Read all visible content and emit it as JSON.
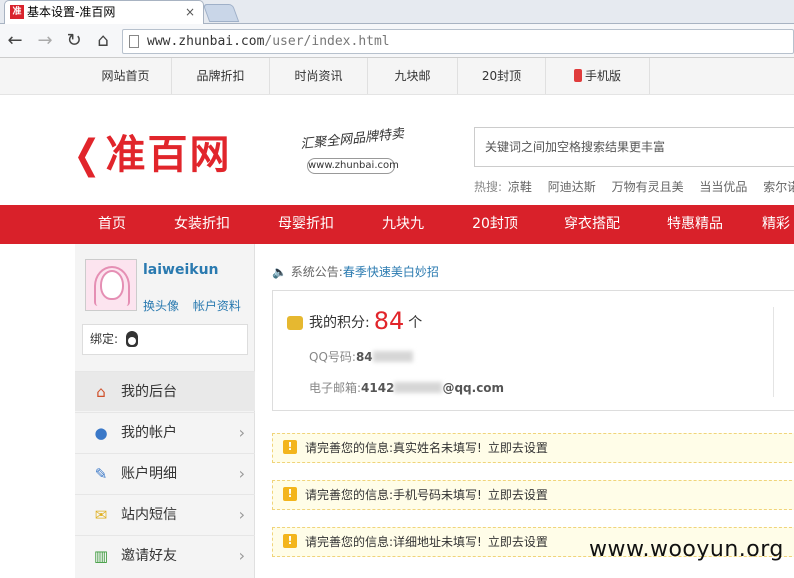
{
  "browser": {
    "tab_title": "基本设置-准百网",
    "tab_close": "×",
    "favicon": "准",
    "url_host": "www.zhunbai.com",
    "url_path": "/user/index.html"
  },
  "toplinks": [
    "网站首页",
    "品牌折扣",
    "时尚资讯",
    "九块邮",
    "20封顶",
    "手机版"
  ],
  "header": {
    "logo_text": "准百网",
    "slogan": "汇聚全网品牌特卖",
    "domain": "www.zhunbai.com",
    "search_placeholder": "关键词之间加空格搜索结果更丰富",
    "hot_label": "热搜:",
    "hot_words": [
      "凉鞋",
      "阿迪达斯",
      "万物有灵且美",
      "当当优品",
      "索尔诺"
    ]
  },
  "rednav": [
    "首页",
    "女装折扣",
    "母婴折扣",
    "九块九",
    "20封顶",
    "穿衣搭配",
    "特惠精品",
    "精彩"
  ],
  "sidebar": {
    "username": "laiweikun",
    "change_avatar": "换头像",
    "account_info": "帐户资料",
    "bind_label": "绑定:",
    "items": [
      {
        "label": "我的后台",
        "icon": "home-icon"
      },
      {
        "label": "我的帐户",
        "icon": "user-icon"
      },
      {
        "label": "账户明细",
        "icon": "edit-icon"
      },
      {
        "label": "站内短信",
        "icon": "mail-icon"
      },
      {
        "label": "邀请好友",
        "icon": "chart-icon"
      }
    ]
  },
  "main": {
    "notice_label": "系统公告:",
    "notice_link": "春季快速美白妙招",
    "points_label": "我的积分:",
    "points_value": "84",
    "points_unit": "个",
    "qq_label": "QQ号码:",
    "qq_value": "84",
    "email_label": "电子邮箱:",
    "email_prefix": "4142",
    "email_suffix": "@qq.com",
    "warnings": [
      {
        "text": "请完善您的信息:真实姓名未填写!",
        "action": "立即去设置"
      },
      {
        "text": "请完善您的信息:手机号码未填写!",
        "action": "立即去设置"
      },
      {
        "text": "请完善您的信息:详细地址未填写!",
        "action": "立即去设置"
      }
    ]
  },
  "watermark": "www.wooyun.org"
}
